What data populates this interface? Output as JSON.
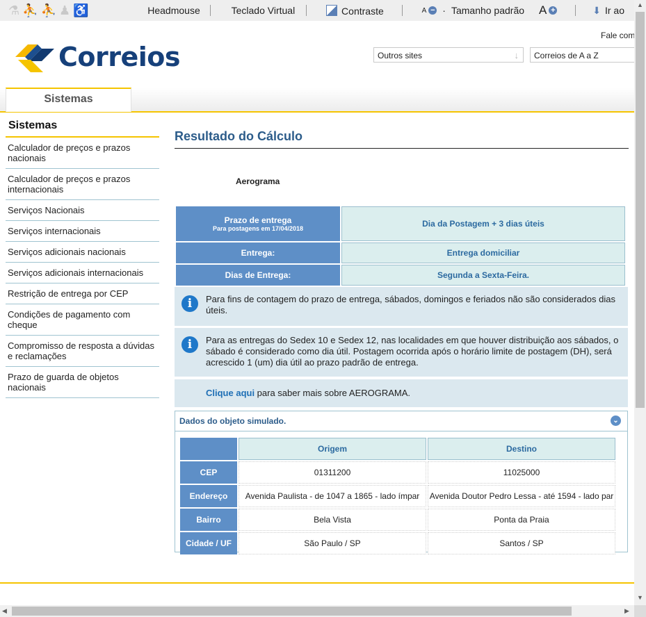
{
  "accessibility_bar": {
    "icons": [
      "elderly-person-icon",
      "person-walking-icon",
      "person-with-baby-icon",
      "pregnant-person-icon",
      "wheelchair-icon"
    ],
    "headmouse": "Headmouse",
    "teclado": "Teclado Virtual",
    "contraste": "Contraste",
    "font_small": "A",
    "font_minus": "−",
    "font_dot": "·",
    "tamanho": "Tamanho padrão",
    "font_large": "A",
    "font_plus": "+",
    "ir_ao": "Ir ao"
  },
  "header": {
    "logo_text": "Correios",
    "fale": "Fale com",
    "outros_sites": "Outros sites",
    "correios_az": "Correios de A a Z",
    "dropdown_arrow": "↓"
  },
  "tabs": {
    "active": "Sistemas"
  },
  "sidebar": {
    "title": "Sistemas",
    "items": [
      "Calculador de preços e prazos nacionais",
      "Calculador de preços e prazos internacionais",
      "Serviços Nacionais",
      "Serviços internacionais",
      "Serviços adicionais nacionais",
      "Serviços adicionais internacionais",
      "Restrição de entrega por CEP",
      "Condições de pagamento com cheque",
      "Compromisso de resposta a dúvidas e reclamações",
      "Prazo de guarda de objetos nacionais"
    ]
  },
  "main": {
    "title": "Resultado do Cálculo",
    "service": "Aerograma",
    "prazo": {
      "label": "Prazo de entrega",
      "sub": "Para postagens em 17/04/2018",
      "value": "Dia da Postagem + 3 dias úteis"
    },
    "entrega": {
      "label": "Entrega:",
      "value": "Entrega domiciliar"
    },
    "dias": {
      "label": "Dias de Entrega:",
      "value": "Segunda a Sexta-Feira."
    },
    "info_icon": "i",
    "info1": "Para fins de contagem do prazo de entrega, sábados, domingos e feriados não são considerados dias úteis.",
    "info2": "Para as entregas do Sedex 10 e Sedex 12, nas localidades em que houver distribuição aos sábados, o sábado é considerado como dia útil. Postagem ocorrida após o horário limite de postagem (DH), será acrescido 1 (um) dia útil ao prazo padrão de entrega.",
    "clique_link": "Clique aqui",
    "clique_rest": " para saber mais sobre AEROGRAMA.",
    "dados": {
      "title": "Dados do objeto simulado.",
      "chevron": "⌄",
      "col_origem": "Origem",
      "col_destino": "Destino",
      "rows": [
        {
          "label": "CEP",
          "origem": "01311200",
          "destino": "11025000"
        },
        {
          "label": "Endereço",
          "origem": "Avenida Paulista - de 1047 a 1865 - lado ímpar",
          "destino": "Avenida Doutor Pedro Lessa - até 1594 - lado par"
        },
        {
          "label": "Bairro",
          "origem": "Bela Vista",
          "destino": "Ponta da Praia"
        },
        {
          "label": "Cidade / UF",
          "origem": "São Paulo / SP",
          "destino": "Santos / SP"
        }
      ]
    }
  },
  "scrollbar": {
    "up": "▲",
    "down": "▼",
    "left": "◀",
    "right": "▶"
  },
  "colors": {
    "accent_yellow": "#f5c400",
    "brand_blue": "#16407a",
    "cell_blue": "#5e8fc7",
    "value_bg": "#dbeeee"
  }
}
